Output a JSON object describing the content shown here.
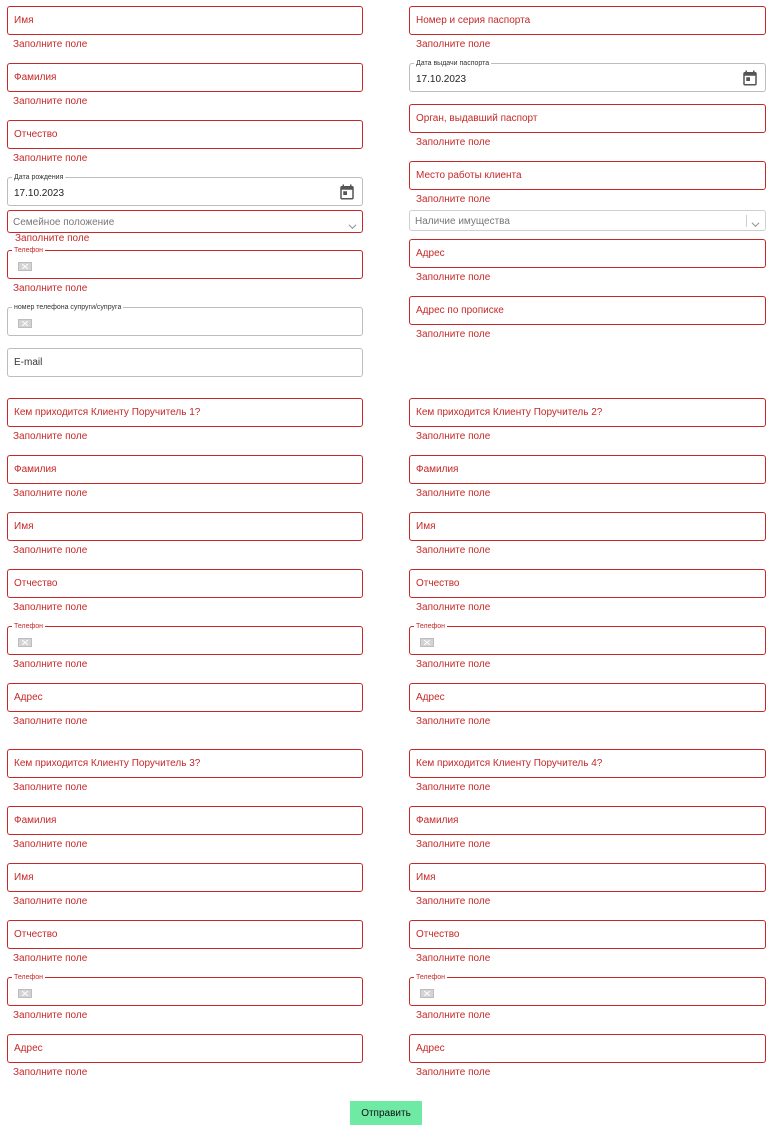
{
  "errors": {
    "required": "Заполните поле"
  },
  "client": {
    "name": "Имя",
    "surname": "Фамилия",
    "patronymic": "Отчество",
    "birth_date_label": "Дата рождения",
    "birth_date_value": "17.10.2023",
    "marital_status_placeholder": "Семейное положение",
    "phone_label": "Телефон",
    "spouse_phone_label": "номер телефона супруги/супруга",
    "email": "E-mail",
    "passport_number": "Номер и серия паспорта",
    "passport_date_label": "Дата выдачи паспорта",
    "passport_date_value": "17.10.2023",
    "passport_issuer": "Орган, выдавший паспорт",
    "workplace": "Место работы клиента",
    "property_placeholder": "Наличие имущества",
    "address": "Адрес",
    "registration_address": "Адрес по прописке"
  },
  "guarantors": [
    {
      "relation": "Кем приходится Клиенту Поручитель 1?",
      "surname": "Фамилия",
      "name": "Имя",
      "patronymic": "Отчество",
      "phone_label": "Телефон",
      "address": "Адрес"
    },
    {
      "relation": "Кем приходится Клиенту Поручитель 2?",
      "surname": "Фамилия",
      "name": "Имя",
      "patronymic": "Отчество",
      "phone_label": "Телефон",
      "address": "Адрес"
    },
    {
      "relation": "Кем приходится Клиенту Поручитель 3?",
      "surname": "Фамилия",
      "name": "Имя",
      "patronymic": "Отчество",
      "phone_label": "Телефон",
      "address": "Адрес"
    },
    {
      "relation": "Кем приходится Клиенту Поручитель 4?",
      "surname": "Фамилия",
      "name": "Имя",
      "patronymic": "Отчество",
      "phone_label": "Телефон",
      "address": "Адрес"
    }
  ],
  "submit_label": "Отправить",
  "icons": {
    "calendar": "calendar-icon",
    "chevron": "chevron-down-icon",
    "flag": "country-flag-icon"
  },
  "colors": {
    "error": "#c62828",
    "submit_bg": "#6eeaa4"
  }
}
